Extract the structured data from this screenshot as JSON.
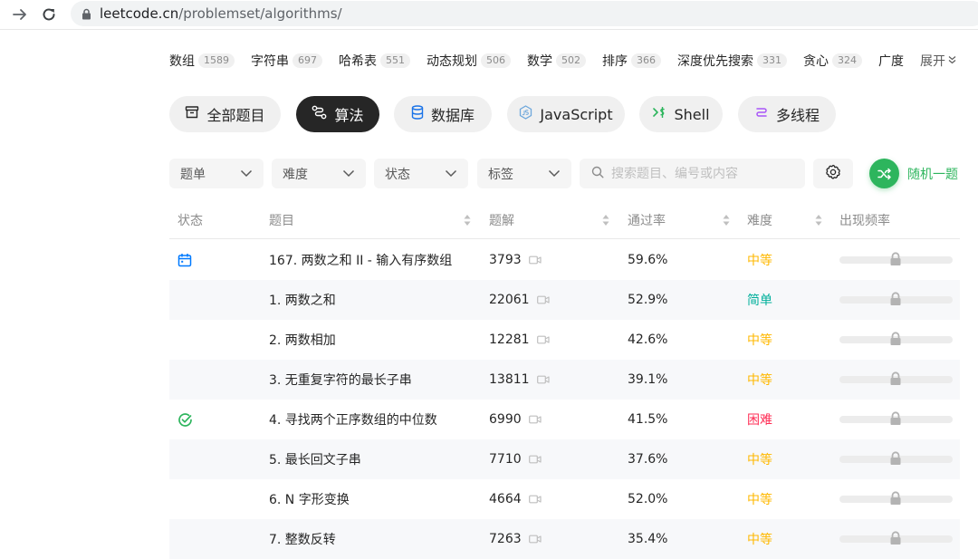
{
  "browser": {
    "url_host": "leetcode.cn",
    "url_path": "/problemset/algorithms/"
  },
  "tags": [
    {
      "label": "数组",
      "count": "1589"
    },
    {
      "label": "字符串",
      "count": "697"
    },
    {
      "label": "哈希表",
      "count": "551"
    },
    {
      "label": "动态规划",
      "count": "506"
    },
    {
      "label": "数学",
      "count": "502"
    },
    {
      "label": "排序",
      "count": "366"
    },
    {
      "label": "深度优先搜索",
      "count": "331"
    },
    {
      "label": "贪心",
      "count": "324"
    },
    {
      "label": "广度"
    }
  ],
  "expand_label": "展开",
  "categories": [
    {
      "label": "全部题目",
      "icon": "archive-icon",
      "active": false
    },
    {
      "label": "算法",
      "icon": "algorithm-icon",
      "active": true
    },
    {
      "label": "数据库",
      "icon": "database-icon",
      "active": false
    },
    {
      "label": "JavaScript",
      "icon": "javascript-icon",
      "active": false
    },
    {
      "label": "Shell",
      "icon": "shell-icon",
      "active": false
    },
    {
      "label": "多线程",
      "icon": "concurrency-icon",
      "active": false
    }
  ],
  "filters": {
    "list": "题单",
    "difficulty": "难度",
    "status": "状态",
    "tags": "标签",
    "search_placeholder": "搜索题目、编号或内容",
    "random": "随机一题"
  },
  "table": {
    "headers": {
      "status": "状态",
      "title": "题目",
      "solutions": "题解",
      "acceptance": "通过率",
      "difficulty": "难度",
      "frequency": "出现频率"
    },
    "rows": [
      {
        "status": "calendar",
        "title": "167. 两数之和 II - 输入有序数组",
        "solutions": "3793",
        "acceptance": "59.6%",
        "difficulty": "中等"
      },
      {
        "status": "",
        "title": "1. 两数之和",
        "solutions": "22061",
        "acceptance": "52.9%",
        "difficulty": "简单"
      },
      {
        "status": "",
        "title": "2. 两数相加",
        "solutions": "12281",
        "acceptance": "42.6%",
        "difficulty": "中等"
      },
      {
        "status": "",
        "title": "3. 无重复字符的最长子串",
        "solutions": "13811",
        "acceptance": "39.1%",
        "difficulty": "中等"
      },
      {
        "status": "solved",
        "title": "4. 寻找两个正序数组的中位数",
        "solutions": "6990",
        "acceptance": "41.5%",
        "difficulty": "困难"
      },
      {
        "status": "",
        "title": "5. 最长回文子串",
        "solutions": "7710",
        "acceptance": "37.6%",
        "difficulty": "中等"
      },
      {
        "status": "",
        "title": "6. N 字形变换",
        "solutions": "4664",
        "acceptance": "52.0%",
        "difficulty": "中等"
      },
      {
        "status": "",
        "title": "7. 整数反转",
        "solutions": "7263",
        "acceptance": "35.4%",
        "difficulty": "中等"
      }
    ]
  },
  "colors": {
    "easy": "#00af9b",
    "medium": "#ffb800",
    "hard": "#ff2d55",
    "accent_green": "#2db55d",
    "calendar_blue": "#007aff"
  }
}
